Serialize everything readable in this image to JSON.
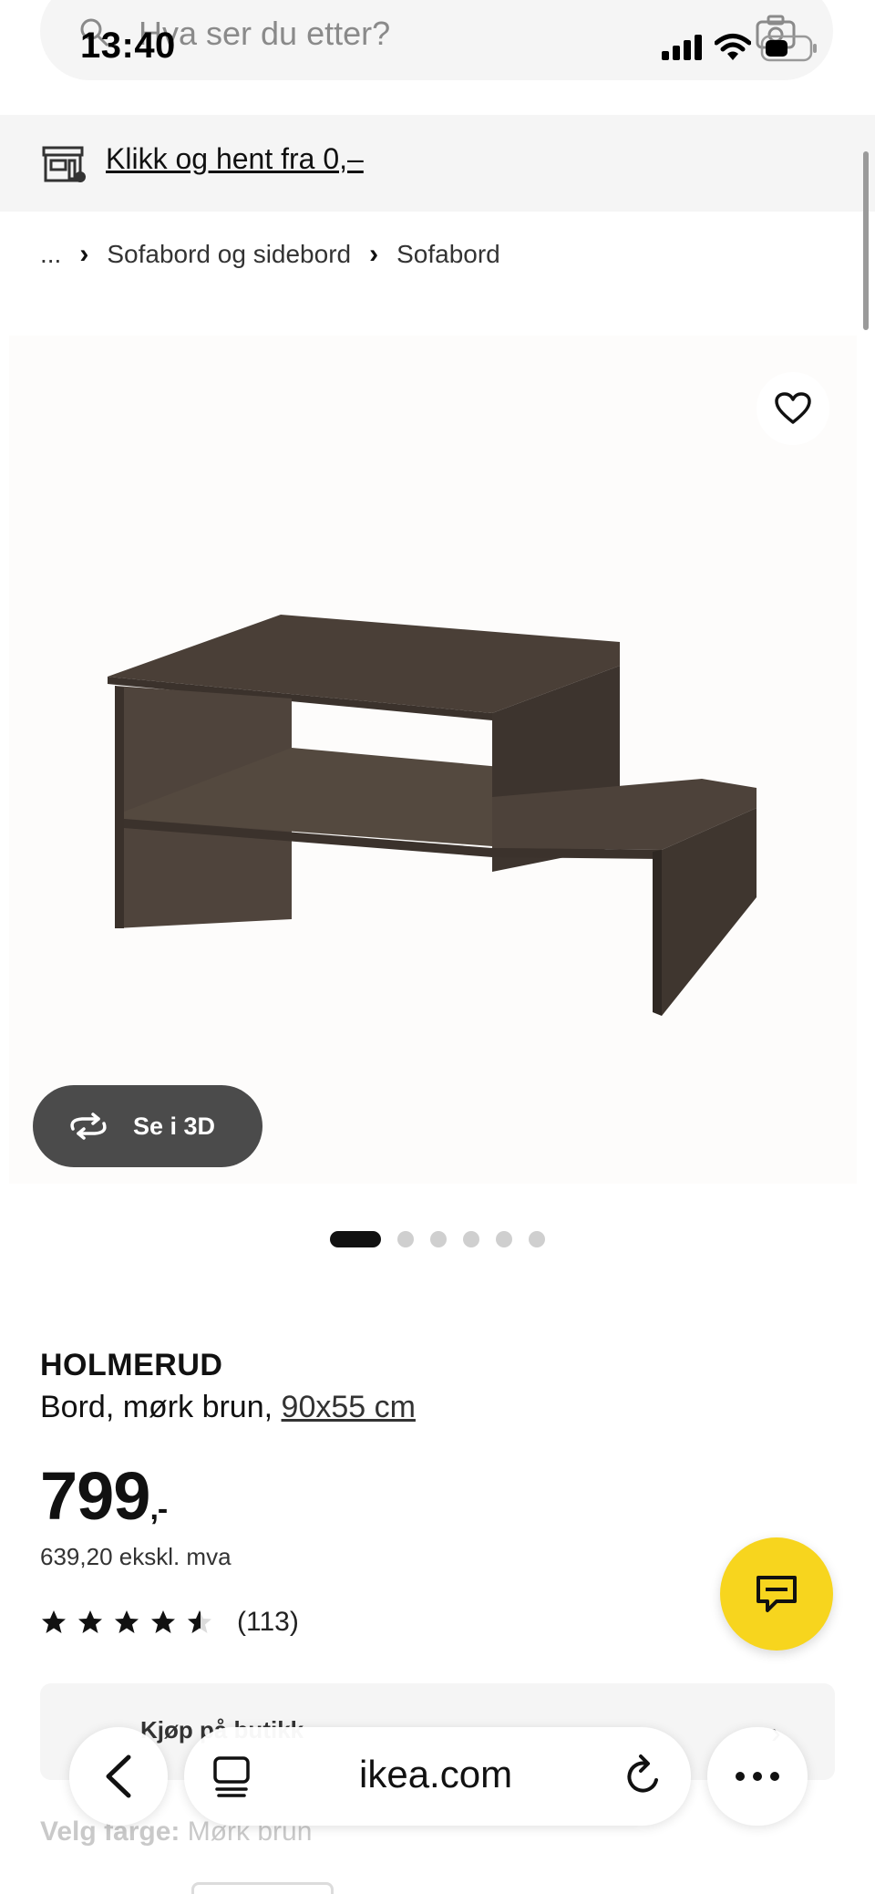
{
  "status_bar": {
    "time": "13:40"
  },
  "search": {
    "placeholder": "Hva ser du etter?"
  },
  "banner": {
    "link_text": "Klikk og hent fra 0,–"
  },
  "breadcrumb": {
    "items": [
      "...",
      "Sofabord og sidebord",
      "Sofabord"
    ]
  },
  "gallery": {
    "view3d_label": "Se i 3D",
    "slide_count": 6,
    "active_slide": 1
  },
  "product": {
    "name": "HOLMERUD",
    "description": "Bord, mørk brun,",
    "size_link": "90x55 cm",
    "price": "799",
    "price_suffix": ",-",
    "price_ex_vat": "639,20 ekskl. mva",
    "rating_value": 4.5,
    "rating_max": 5,
    "review_count": "(113)"
  },
  "store_row": {
    "label": "Kjøp på butikk"
  },
  "color_select": {
    "label": "Velg farge:",
    "value": "Mørk brun"
  },
  "browser": {
    "url": "ikea.com"
  },
  "colors": {
    "chat_fab": "#f7d51e",
    "banner_bg": "#f5f5f5",
    "view3d_bg": "#4b4b4b"
  },
  "icons": [
    "search-icon",
    "camera-icon",
    "signal-icon",
    "wifi-icon",
    "battery-icon",
    "store-icon",
    "heart-icon",
    "rotate-3d-icon",
    "star-icon",
    "chat-icon",
    "back-icon",
    "tabs-icon",
    "reload-icon",
    "more-icon"
  ]
}
